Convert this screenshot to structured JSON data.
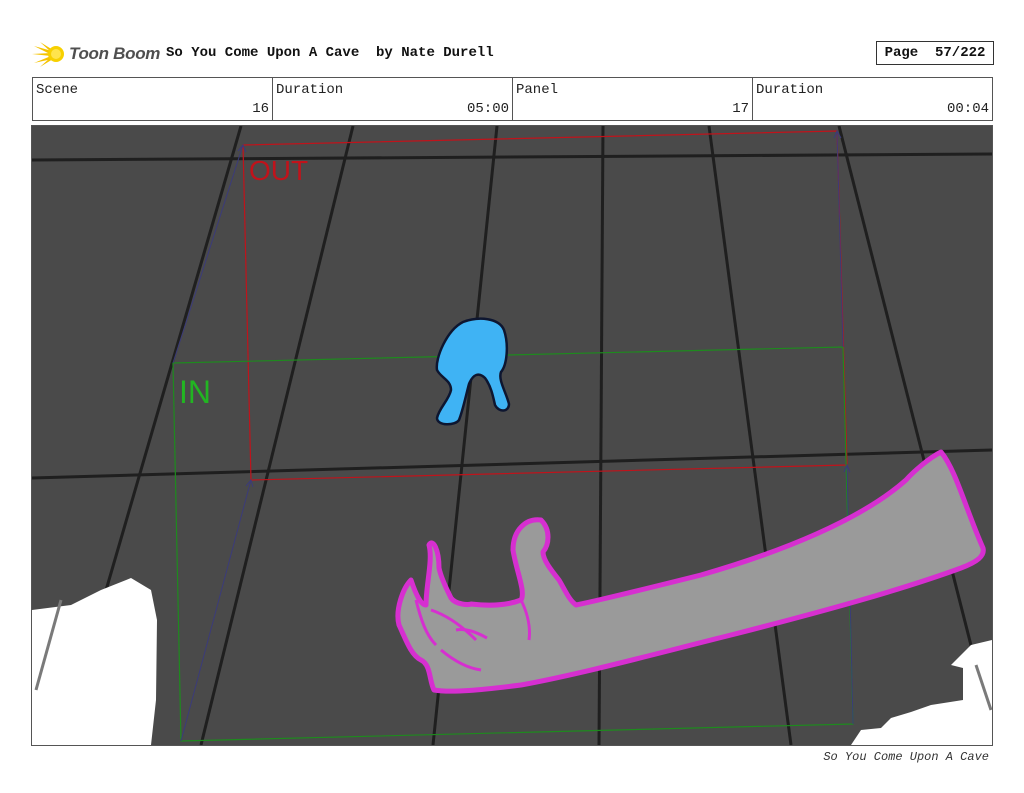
{
  "header": {
    "logo_text": "Toon Boom",
    "title": "So You Come Upon A Cave  by Nate Durell",
    "page_label": "Page  57/222"
  },
  "info": {
    "scene_label": "Scene",
    "scene_value": "16",
    "duration1_label": "Duration",
    "duration1_value": "05:00",
    "panel_label": "Panel",
    "panel_value": "17",
    "duration2_label": "Duration",
    "duration2_value": "00:04"
  },
  "panel_drawing": {
    "out_label": "OUT",
    "in_label": "IN",
    "colors": {
      "background": "#4a4a4a",
      "grid": "#1f1f1f",
      "out_frame": "#c0131b",
      "in_frame": "#1e8a1e",
      "creature": "#3fb3f4",
      "arm_fill": "#9a9a9a",
      "arm_outline": "#d62fd0"
    }
  },
  "footer": {
    "text": "So You Come Upon A Cave"
  }
}
